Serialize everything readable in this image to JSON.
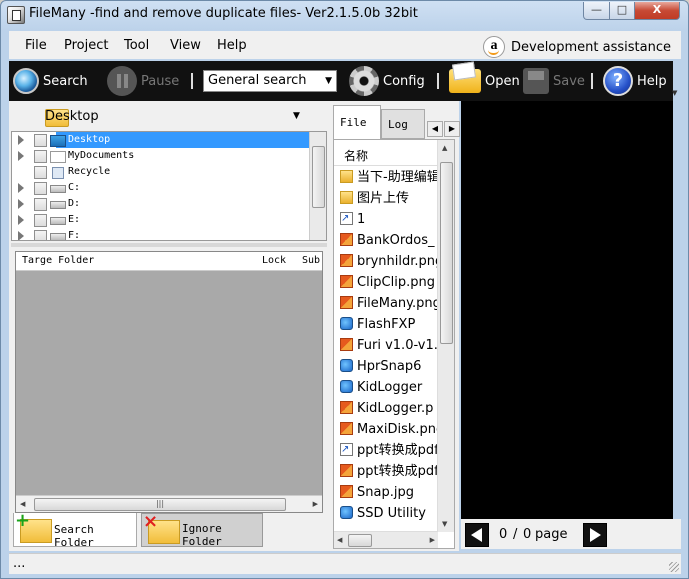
{
  "window": {
    "title": "FileMany -find and remove duplicate files- Ver2.1.5.0b 32bit",
    "controls": [
      "—",
      "□",
      "X"
    ]
  },
  "menu": {
    "items": [
      "File",
      "Project",
      "Tool",
      "View",
      "Help"
    ],
    "dev_assist": "Development assistance"
  },
  "toolbar": {
    "search": "Search",
    "pause": "Pause",
    "search_mode": "General search",
    "config": "Config",
    "open": "Open",
    "save": "Save",
    "help": "Help"
  },
  "location": {
    "current": "Desktop"
  },
  "tree": [
    {
      "label": "Desktop",
      "icon": "desktop-icon",
      "expandable": true,
      "selected": true
    },
    {
      "label": "MyDocuments",
      "icon": "documents-icon",
      "expandable": true,
      "selected": false
    },
    {
      "label": "Recycle",
      "icon": "recycle-bin-icon",
      "expandable": false,
      "selected": false
    },
    {
      "label": "C:",
      "icon": "drive-icon",
      "expandable": true,
      "selected": false
    },
    {
      "label": "D:",
      "icon": "drive-icon",
      "expandable": true,
      "selected": false
    },
    {
      "label": "E:",
      "icon": "drive-icon",
      "expandable": true,
      "selected": false
    },
    {
      "label": "F:",
      "icon": "drive-icon",
      "expandable": true,
      "selected": false
    }
  ],
  "target_list": {
    "columns": [
      "Targe Folder",
      "Lock",
      "Sub"
    ]
  },
  "bottom_tabs": {
    "search_folder": "Search Folder",
    "ignore_folder": "Ignore Folder"
  },
  "file_tabs": {
    "file": "File",
    "log": "Log"
  },
  "file_list": {
    "header": "名称",
    "items": [
      {
        "name": "当下-助理编辑",
        "icon": "folder"
      },
      {
        "name": "图片上传",
        "icon": "folder"
      },
      {
        "name": "1",
        "icon": "shortcut"
      },
      {
        "name": "BankOrdos_",
        "icon": "image"
      },
      {
        "name": "brynhildr.png",
        "icon": "image"
      },
      {
        "name": "ClipClip.png",
        "icon": "image"
      },
      {
        "name": "FileMany.png",
        "icon": "image"
      },
      {
        "name": "FlashFXP",
        "icon": "app"
      },
      {
        "name": "Furi v1.0-v1.",
        "icon": "image"
      },
      {
        "name": "HprSnap6",
        "icon": "app"
      },
      {
        "name": "KidLogger",
        "icon": "app"
      },
      {
        "name": "KidLogger.p",
        "icon": "image"
      },
      {
        "name": "MaxiDisk.png",
        "icon": "image"
      },
      {
        "name": "ppt转换成pdf",
        "icon": "shortcut"
      },
      {
        "name": "ppt转换成pdf",
        "icon": "image"
      },
      {
        "name": "Snap.jpg",
        "icon": "image"
      },
      {
        "name": "SSD Utility",
        "icon": "app"
      }
    ]
  },
  "pager": {
    "current": "0",
    "separator": "/",
    "total": "0",
    "unit": "page"
  },
  "status": {
    "text": "..."
  }
}
